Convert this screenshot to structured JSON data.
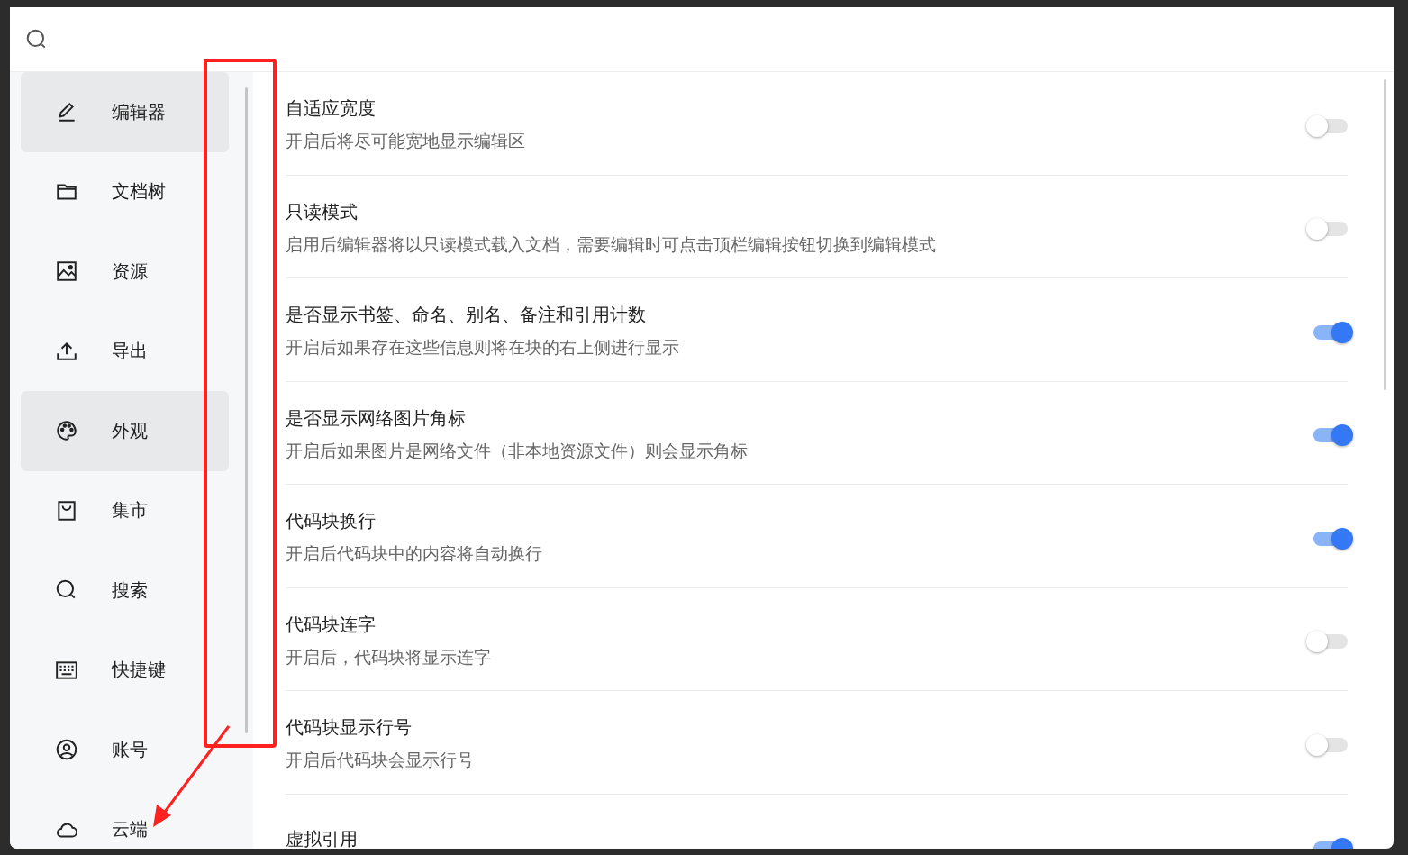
{
  "sidebar": {
    "items": [
      {
        "label": "编辑器",
        "selected": true
      },
      {
        "label": "文档树",
        "selected": false
      },
      {
        "label": "资源",
        "selected": false
      },
      {
        "label": "导出",
        "selected": false
      },
      {
        "label": "外观",
        "selected": true
      },
      {
        "label": "集市",
        "selected": false
      },
      {
        "label": "搜索",
        "selected": false
      },
      {
        "label": "快捷键",
        "selected": false
      },
      {
        "label": "账号",
        "selected": false
      },
      {
        "label": "云端",
        "selected": false
      }
    ]
  },
  "settings": [
    {
      "title": "自适应宽度",
      "description": "开启后将尽可能宽地显示编辑区",
      "on": false
    },
    {
      "title": "只读模式",
      "description": "启用后编辑器将以只读模式载入文档，需要编辑时可点击顶栏编辑按钮切换到编辑模式",
      "on": false
    },
    {
      "title": "是否显示书签、命名、别名、备注和引用计数",
      "description": "开启后如果存在这些信息则将在块的右上侧进行显示",
      "on": true
    },
    {
      "title": "是否显示网络图片角标",
      "description": "开启后如果图片是网络文件（非本地资源文件）则会显示角标",
      "on": true
    },
    {
      "title": "代码块换行",
      "description": "开启后代码块中的内容将自动换行",
      "on": true
    },
    {
      "title": "代码块连字",
      "description": "开启后，代码块将显示连字",
      "on": false
    },
    {
      "title": "代码块显示行号",
      "description": "开启后代码块会显示行号",
      "on": false
    },
    {
      "title": "虚拟引用",
      "on": true
    }
  ]
}
